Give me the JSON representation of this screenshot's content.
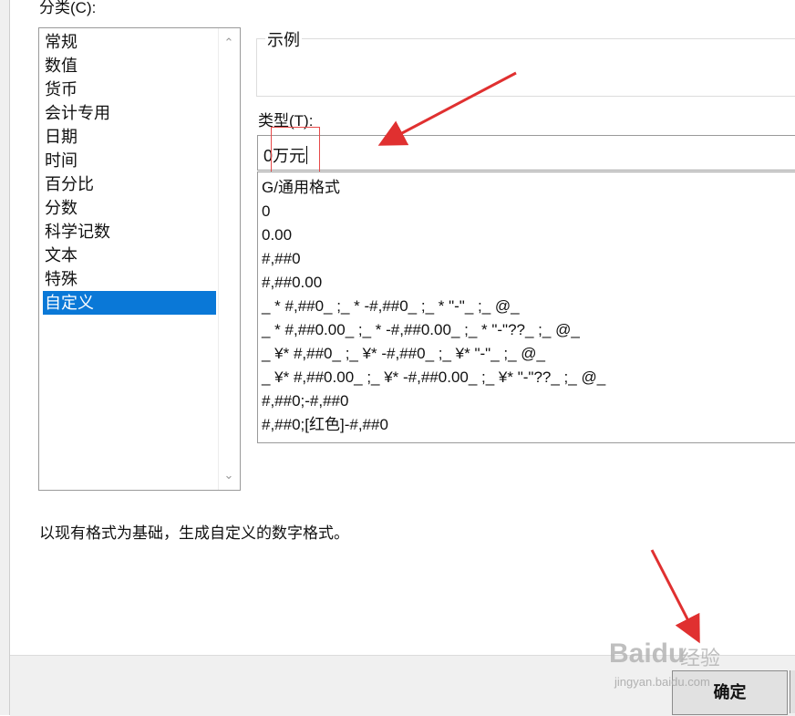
{
  "dialog": {
    "category_label": "分类(C):",
    "categories": [
      "常规",
      "数值",
      "货币",
      "会计专用",
      "日期",
      "时间",
      "百分比",
      "分数",
      "科学记数",
      "文本",
      "特殊",
      "自定义"
    ],
    "selected_category": "自定义",
    "sample_label": "示例",
    "sample_value": "",
    "type_label": "类型(T):",
    "type_value": "0万元",
    "format_codes": [
      "G/通用格式",
      "0",
      "0.00",
      "#,##0",
      "#,##0.00",
      "_ * #,##0_ ;_ * -#,##0_ ;_ * \"-\"_ ;_ @_",
      "_ * #,##0.00_ ;_ * -#,##0.00_ ;_ * \"-\"??_ ;_ @_",
      "_ ¥* #,##0_ ;_ ¥* -#,##0_ ;_ ¥* \"-\"_ ;_ @_",
      "_ ¥* #,##0.00_ ;_ ¥* -#,##0.00_ ;_ ¥* \"-\"??_ ;_ @_",
      "#,##0;-#,##0",
      "#,##0;[红色]-#,##0"
    ],
    "description": "以现有格式为基础，生成自定义的数字格式。",
    "ok_label": "确定"
  },
  "watermark": {
    "logo": "Baidu",
    "text": "经验",
    "url": "jingyan.baidu.com"
  },
  "annotation_color": "#e03030"
}
